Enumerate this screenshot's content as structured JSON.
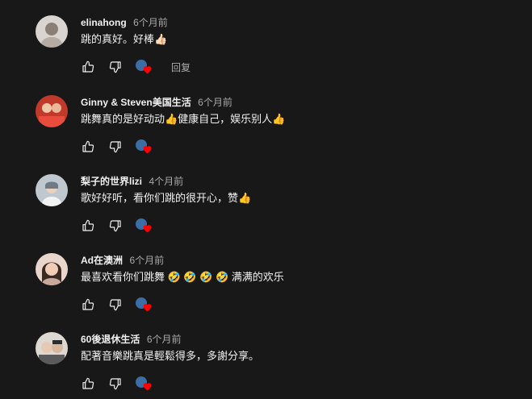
{
  "comments": [
    {
      "author": "elinahong",
      "time": "6个月前",
      "text": "跳的真好。好棒👍🏻",
      "reply_label": "回复",
      "show_reply": true,
      "avatar_colors": [
        "#d9d4cf",
        "#8a7f76"
      ]
    },
    {
      "author": "Ginny & Steven美国生活",
      "time": "6个月前",
      "text": "跳舞真的是好动动👍健康自己，娱乐别人👍",
      "reply_label": "",
      "show_reply": false,
      "avatar_colors": [
        "#c0392b",
        "#f0c8a8"
      ]
    },
    {
      "author": "梨子的世界lizi",
      "time": "4个月前",
      "text": "歌好好听，看你们跳的很开心，赞👍",
      "reply_label": "",
      "show_reply": false,
      "avatar_colors": [
        "#bfc7cf",
        "#6f7a84"
      ]
    },
    {
      "author": "Ad在澳洲",
      "time": "6个月前",
      "text": "最喜欢看你们跳舞 🤣 🤣 🤣 🤣 满满的欢乐",
      "reply_label": "",
      "show_reply": false,
      "avatar_colors": [
        "#e8d6cc",
        "#3a2a22"
      ]
    },
    {
      "author": "60後退休生活",
      "time": "6个月前",
      "text": "配著音樂跳真是輕鬆得多，多謝分享。",
      "reply_label": "",
      "show_reply": false,
      "avatar_colors": [
        "#ddd8d2",
        "#2c2c2c"
      ]
    }
  ],
  "icons": {
    "like": "thumbs-up-icon",
    "dislike": "thumbs-down-icon",
    "creator_heart": "creator-heart-icon"
  },
  "colors": {
    "background": "#181818",
    "text": "#f1f1f1",
    "secondary_text": "#aaaaaa",
    "heart": "#ff0000"
  }
}
